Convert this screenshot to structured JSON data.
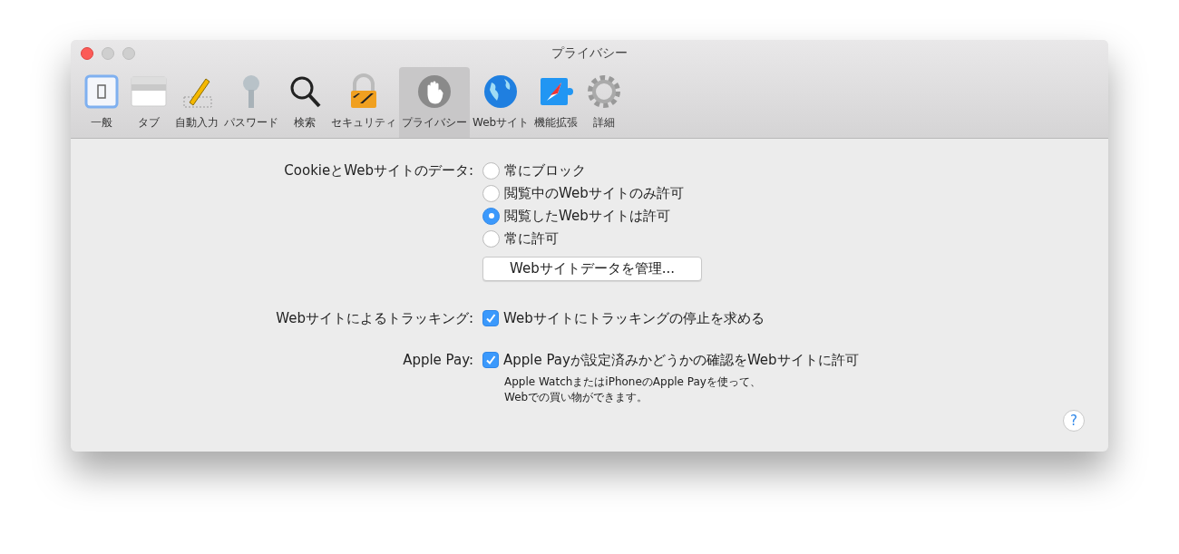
{
  "window": {
    "title": "プライバシー"
  },
  "toolbar": [
    {
      "label": "一般",
      "selected": false
    },
    {
      "label": "タブ",
      "selected": false
    },
    {
      "label": "自動入力",
      "selected": false
    },
    {
      "label": "パスワード",
      "selected": false
    },
    {
      "label": "検索",
      "selected": false
    },
    {
      "label": "セキュリティ",
      "selected": false
    },
    {
      "label": "プライバシー",
      "selected": true
    },
    {
      "label": "Webサイト",
      "selected": false
    },
    {
      "label": "機能拡張",
      "selected": false
    },
    {
      "label": "詳細",
      "selected": false
    }
  ],
  "cookies": {
    "label": "CookieとWebサイトのデータ:",
    "options": [
      {
        "label": "常にブロック",
        "selected": false
      },
      {
        "label": "閲覧中のWebサイトのみ許可",
        "selected": false
      },
      {
        "label": "閲覧したWebサイトは許可",
        "selected": true
      },
      {
        "label": "常に許可",
        "selected": false
      }
    ],
    "button": "Webサイトデータを管理..."
  },
  "tracking": {
    "label": "Webサイトによるトラッキング:",
    "checkbox": {
      "label": "Webサイトにトラッキングの停止を求める",
      "checked": true
    }
  },
  "apple_pay": {
    "label": "Apple Pay:",
    "checkbox": {
      "label": "Apple Payが設定済みかどうかの確認をWebサイトに許可",
      "checked": true
    },
    "note": "Apple WatchまたはiPhoneのApple Payを使って、\nWebでの買い物ができます。"
  },
  "help": "?"
}
